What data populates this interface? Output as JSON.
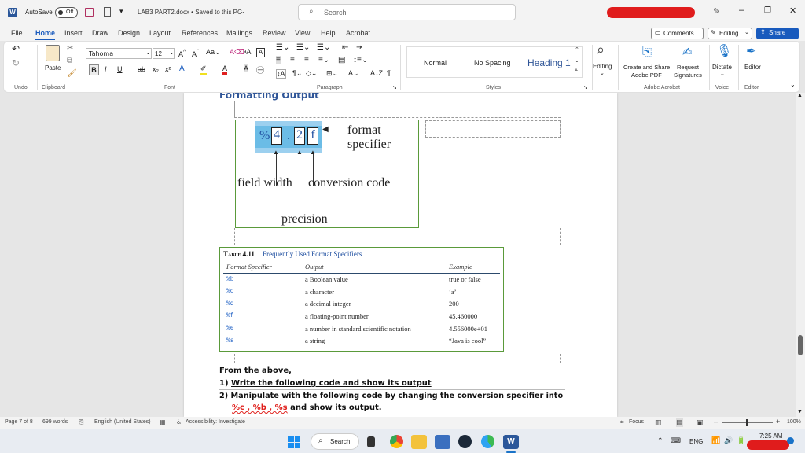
{
  "titlebar": {
    "autosave_label": "AutoSave",
    "autosave_state": "Off",
    "document_title": "LAB3 PART2.docx • Saved to this PC",
    "search_placeholder": "Search"
  },
  "menu_tabs": [
    "File",
    "Home",
    "Insert",
    "Draw",
    "Design",
    "Layout",
    "References",
    "Mailings",
    "Review",
    "View",
    "Help",
    "Acrobat"
  ],
  "active_tab": "Home",
  "top_right": {
    "comments": "Comments",
    "editing": "Editing",
    "share": "Share"
  },
  "ribbon": {
    "clipboard": {
      "paste": "Paste",
      "group": "Clipboard"
    },
    "undo_group": "Undo",
    "font": {
      "name": "Tahoma",
      "size": "12",
      "group": "Font"
    },
    "paragraph_group": "Paragraph",
    "styles": {
      "items": [
        "Normal",
        "No Spacing",
        "Heading 1"
      ],
      "group": "Styles"
    },
    "editing": {
      "label": "Editing"
    },
    "acrobat": {
      "create_share_line1": "Create and Share",
      "create_share_line2": "Adobe PDF",
      "request_line1": "Request",
      "request_line2": "Signatures",
      "group": "Adobe Acrobat"
    },
    "voice": {
      "dictate": "Dictate",
      "group": "Voice"
    },
    "editor": {
      "label": "Editor",
      "group": "Editor"
    }
  },
  "document": {
    "heading": "Formatting Output",
    "diagram": {
      "chars": [
        "%",
        "4",
        ".",
        "2",
        "f"
      ],
      "format_specifier": "format specifier",
      "field_width": "field width",
      "conversion_code": "conversion code",
      "precision": "precision"
    },
    "table": {
      "label": "Table 4.11",
      "caption": "Frequently Used Format Specifiers",
      "headers": [
        "Format Specifier",
        "Output",
        "Example"
      ],
      "rows": [
        [
          "%b",
          "a Boolean value",
          "true or false"
        ],
        [
          "%c",
          "a character",
          "‘a’"
        ],
        [
          "%d",
          "a decimal integer",
          "200"
        ],
        [
          "%f",
          "a floating-point number",
          "45.460000"
        ],
        [
          "%e",
          "a number in standard scientific notation",
          "4.556000e+01"
        ],
        [
          "%s",
          "a string",
          "“Java is cool”"
        ]
      ]
    },
    "body": {
      "from_above": "From the above,",
      "item1_num": "1)",
      "item1_text": "Write the following code and show its output",
      "item2_num": "2)",
      "item2_text": "Manipulate with the following code by changing the conversion specifier into",
      "item2_specs": "%c , %b , %s",
      "item2_end": " and show its output."
    }
  },
  "statusbar": {
    "page": "Page 7 of 8",
    "words": "699 words",
    "language": "English (United States)",
    "accessibility": "Accessibility: Investigate",
    "focus": "Focus",
    "zoom": "100%"
  },
  "taskbar": {
    "search": "Search",
    "language": "ENG",
    "time": "7:25 AM"
  },
  "colors": {
    "accent": "#185abd",
    "word_blue": "#2b579a",
    "red_text": "#e0201c",
    "table_border": "#5a9a3a"
  }
}
